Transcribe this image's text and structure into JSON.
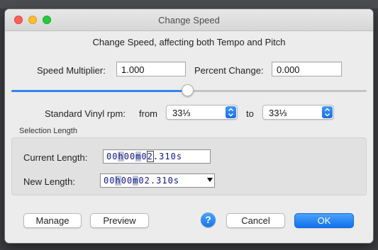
{
  "window": {
    "title": "Change Speed"
  },
  "dialog": {
    "heading": "Change Speed, affecting both Tempo and Pitch",
    "speed_multiplier": {
      "label": "Speed Multiplier:",
      "value": "1.000"
    },
    "percent_change": {
      "label": "Percent Change:",
      "value": "0.000"
    },
    "slider": {
      "position_fraction": 0.5
    },
    "vinyl": {
      "label": "Standard Vinyl rpm:",
      "from_label": "from",
      "from_value": "33⅓",
      "to_label": "to",
      "to_value": "33⅓"
    },
    "selection": {
      "group_title": "Selection Length",
      "current_length_label": "Current Length:",
      "current_length_value": "00h00m02.310s",
      "new_length_label": "New Length:",
      "new_length_value": "00h00m02.310s"
    },
    "buttons": {
      "manage": "Manage",
      "preview": "Preview",
      "help": "?",
      "cancel": "Cancel",
      "ok": "OK"
    }
  },
  "colors": {
    "accent": "#2f84ef",
    "time_digits": "#0c148f"
  }
}
